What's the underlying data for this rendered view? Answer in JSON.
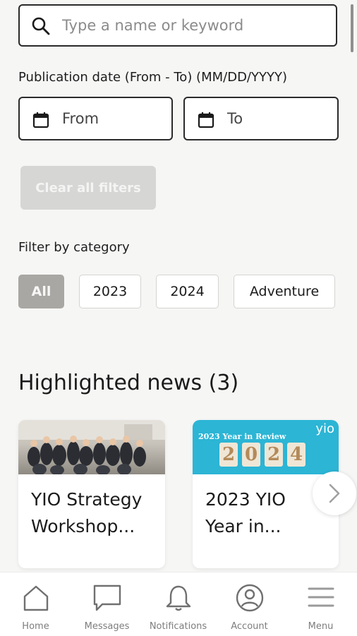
{
  "search": {
    "placeholder": "Type a name or keyword",
    "value": ""
  },
  "date_filter": {
    "label": "Publication date (From - To) (MM/DD/YYYY)",
    "from_label": "From",
    "to_label": "To"
  },
  "clear_filters_label": "Clear all filters",
  "category_filter": {
    "label": "Filter by category",
    "chips": [
      "All",
      "2023",
      "2024",
      "Adventure"
    ],
    "selected": "All"
  },
  "highlighted": {
    "title": "Highlighted news (3)",
    "cards": [
      {
        "title_line1": "YIO Strategy",
        "title_line2": "Workshop..."
      },
      {
        "title_line1": "2023 YIO",
        "title_line2": "Year in...",
        "image_text": "2023 Year in Review",
        "image_logo": "yio",
        "image_digits": [
          "2",
          "0",
          "2",
          "4"
        ]
      }
    ]
  },
  "bottom_nav": [
    {
      "label": "Home",
      "icon": "home-icon"
    },
    {
      "label": "Messages",
      "icon": "message-icon"
    },
    {
      "label": "Notifications",
      "icon": "bell-icon"
    },
    {
      "label": "Account",
      "icon": "account-icon"
    },
    {
      "label": "Menu",
      "icon": "menu-icon"
    }
  ],
  "colors": {
    "background": "#f6f6f5",
    "selected_chip": "#a9a7a3",
    "disabled_button": "#d6d6d4",
    "image_blue": "#2cb5d5"
  }
}
